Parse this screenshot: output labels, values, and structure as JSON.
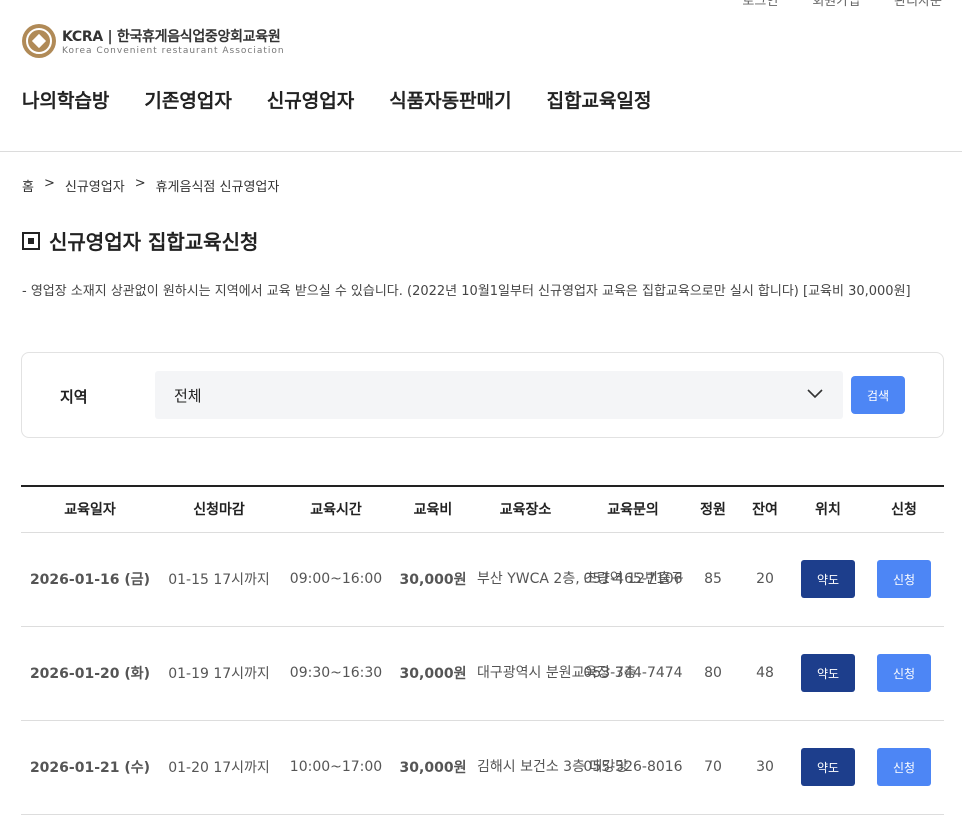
{
  "util_links": [
    "로그인",
    "회원가입",
    "관리자문"
  ],
  "logo": {
    "title": "KCRA | 한국휴게음식업중앙회교육원",
    "subtitle": "Korea Convenient restaurant Association"
  },
  "nav": [
    "나의학습방",
    "기존영업자",
    "신규영업자",
    "식품자동판매기",
    "집합교육일정"
  ],
  "breadcrumb": [
    "홈",
    ">",
    "신규영업자",
    ">",
    "휴게음식점 신규영업자"
  ],
  "page_title": "신규영업자 집합교육신청",
  "notice": "- 영업장 소재지 상관없이 원하시는 지역에서 교육 받으실 수 있습니다. (2022년 10월1일부터 신규영업자 교육은 집합교육으로만 실시 합니다) [교육비 30,000원]",
  "search": {
    "label": "지역",
    "selected": "전체",
    "button": "검색"
  },
  "table": {
    "headers": [
      "교육일자",
      "신청마감",
      "교육시간",
      "교육비",
      "교육장소",
      "교육문의",
      "정원",
      "잔여",
      "위치",
      "신청"
    ],
    "rows": [
      {
        "date": "2026-01-16 (금)",
        "deadline": "01-15 17시까지",
        "time": "09:00~16:00",
        "fee": "30,000원",
        "place": "부산 YWCA 2층, 초량역 12번출구",
        "phone": "051-465-7106",
        "capacity": "85",
        "remaining": "20",
        "map": "약도",
        "apply": "신청"
      },
      {
        "date": "2026-01-20 (화)",
        "deadline": "01-19 17시까지",
        "time": "09:30~16:30",
        "fee": "30,000원",
        "place": "대구광역시 분원교육장 3층",
        "phone": "053-744-7474",
        "capacity": "80",
        "remaining": "48",
        "map": "약도",
        "apply": "신청"
      },
      {
        "date": "2026-01-21 (수)",
        "deadline": "01-20 17시까지",
        "time": "10:00~17:00",
        "fee": "30,000원",
        "place": "김해시 보건소 3층 대강당",
        "phone": "055-326-8016",
        "capacity": "70",
        "remaining": "30",
        "map": "약도",
        "apply": "신청"
      }
    ]
  },
  "colors": {
    "accent": "#4d86f5",
    "map_button": "#1d3e8c",
    "logo_gold": "#b08a57"
  }
}
